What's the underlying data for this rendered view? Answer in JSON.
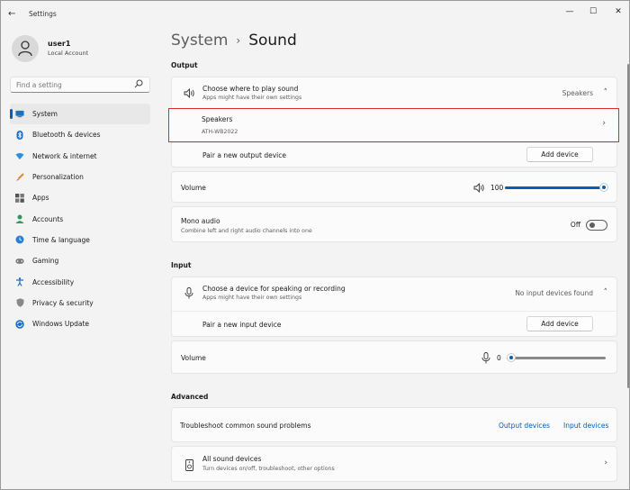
{
  "window": {
    "title": "Settings",
    "back_glyph": "←",
    "minimize_glyph": "—",
    "maximize_glyph": "☐",
    "close_glyph": "✕"
  },
  "user": {
    "name": "user1",
    "account": "Local Account"
  },
  "search": {
    "placeholder": "Find a setting",
    "icon": "search-icon"
  },
  "sidebar": {
    "items": [
      {
        "label": "System",
        "icon": "monitor-icon",
        "active": true
      },
      {
        "label": "Bluetooth & devices",
        "icon": "bluetooth-icon"
      },
      {
        "label": "Network & internet",
        "icon": "wifi-icon"
      },
      {
        "label": "Personalization",
        "icon": "brush-icon"
      },
      {
        "label": "Apps",
        "icon": "apps-icon"
      },
      {
        "label": "Accounts",
        "icon": "person-icon"
      },
      {
        "label": "Time & language",
        "icon": "globe-clock-icon"
      },
      {
        "label": "Gaming",
        "icon": "gamepad-icon"
      },
      {
        "label": "Accessibility",
        "icon": "accessibility-icon"
      },
      {
        "label": "Privacy & security",
        "icon": "shield-icon"
      },
      {
        "label": "Windows Update",
        "icon": "update-icon"
      }
    ]
  },
  "breadcrumb": {
    "parent": "System",
    "separator": "›",
    "current": "Sound"
  },
  "output": {
    "heading": "Output",
    "choose_title": "Choose where to play sound",
    "choose_sub": "Apps might have their own settings",
    "choose_value": "Speakers",
    "device_name": "Speakers",
    "device_model": "ATH-WB2022",
    "pair_label": "Pair a new output device",
    "add_button": "Add device",
    "volume_label": "Volume",
    "volume_value": "100",
    "volume_level": 1.0,
    "mono_title": "Mono audio",
    "mono_sub": "Combine left and right audio channels into one",
    "mono_state": "Off"
  },
  "input": {
    "heading": "Input",
    "choose_title": "Choose a device for speaking or recording",
    "choose_sub": "Apps might have their own settings",
    "choose_value": "No input devices found",
    "pair_label": "Pair a new input device",
    "add_button": "Add device",
    "volume_label": "Volume",
    "volume_value": "0",
    "volume_level": 0.0
  },
  "advanced": {
    "heading": "Advanced",
    "troubleshoot_label": "Troubleshoot common sound problems",
    "output_link": "Output devices",
    "input_link": "Input devices",
    "all_title": "All sound devices",
    "all_sub": "Turn devices on/off, troubleshoot, other options"
  },
  "colors": {
    "accent": "#005fb8",
    "highlight_border": "#d92b2b"
  },
  "glyphs": {
    "chevron_up": "˄",
    "chevron_right": "›"
  }
}
